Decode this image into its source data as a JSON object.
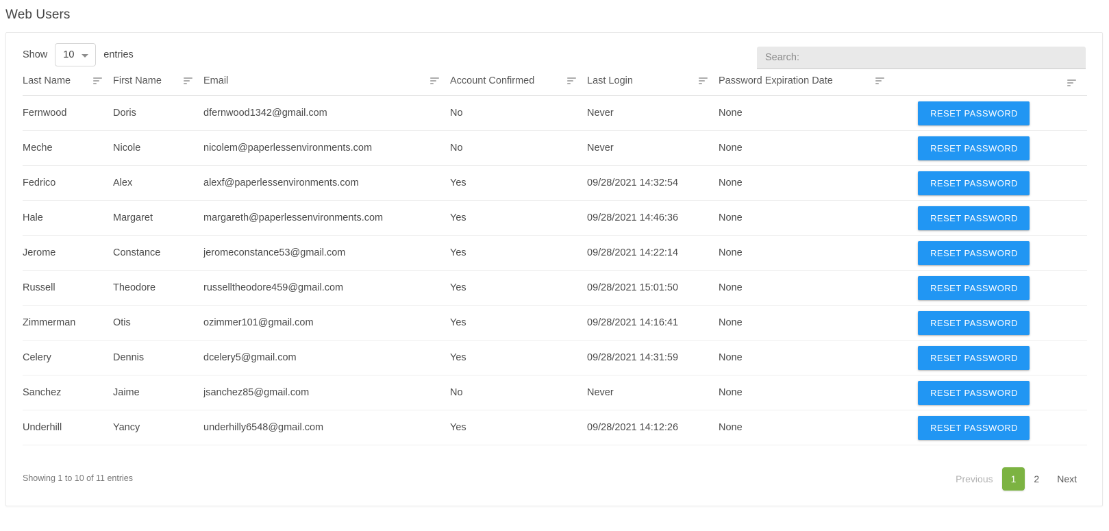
{
  "page": {
    "title": "Web Users"
  },
  "controls": {
    "length_label": "Show",
    "length_value": "10",
    "length_suffix": "entries",
    "search_placeholder": "Search:",
    "search_value": ""
  },
  "table": {
    "columns": [
      {
        "label": "Last Name",
        "sort_icon": "sort-descending-icon"
      },
      {
        "label": "First Name",
        "sort_icon": "sort-descending-icon"
      },
      {
        "label": "Email",
        "sort_icon": "sort-descending-icon"
      },
      {
        "label": "Account Confirmed",
        "sort_icon": "sort-descending-icon"
      },
      {
        "label": "Last Login",
        "sort_icon": "sort-descending-icon"
      },
      {
        "label": "Password Expiration Date",
        "sort_icon": "sort-descending-icon"
      },
      {
        "label": "",
        "sort_icon": "sort-descending-icon"
      }
    ],
    "action_label": "RESET PASSWORD",
    "rows": [
      {
        "last_name": "Fernwood",
        "first_name": "Doris",
        "email": "dfernwood1342@gmail.com",
        "account_confirmed": "No",
        "last_login": "Never",
        "password_expiration_date": "None"
      },
      {
        "last_name": "Meche",
        "first_name": "Nicole",
        "email": "nicolem@paperlessenvironments.com",
        "account_confirmed": "No",
        "last_login": "Never",
        "password_expiration_date": "None"
      },
      {
        "last_name": "Fedrico",
        "first_name": "Alex",
        "email": "alexf@paperlessenvironments.com",
        "account_confirmed": "Yes",
        "last_login": "09/28/2021 14:32:54",
        "password_expiration_date": "None"
      },
      {
        "last_name": "Hale",
        "first_name": "Margaret",
        "email": "margareth@paperlessenvironments.com",
        "account_confirmed": "Yes",
        "last_login": "09/28/2021 14:46:36",
        "password_expiration_date": "None"
      },
      {
        "last_name": "Jerome",
        "first_name": "Constance",
        "email": "jeromeconstance53@gmail.com",
        "account_confirmed": "Yes",
        "last_login": "09/28/2021 14:22:14",
        "password_expiration_date": "None"
      },
      {
        "last_name": "Russell",
        "first_name": "Theodore",
        "email": "russelltheodore459@gmail.com",
        "account_confirmed": "Yes",
        "last_login": "09/28/2021 15:01:50",
        "password_expiration_date": "None"
      },
      {
        "last_name": "Zimmerman",
        "first_name": "Otis",
        "email": "ozimmer101@gmail.com",
        "account_confirmed": "Yes",
        "last_login": "09/28/2021 14:16:41",
        "password_expiration_date": "None"
      },
      {
        "last_name": "Celery",
        "first_name": "Dennis",
        "email": "dcelery5@gmail.com",
        "account_confirmed": "Yes",
        "last_login": "09/28/2021 14:31:59",
        "password_expiration_date": "None"
      },
      {
        "last_name": "Sanchez",
        "first_name": "Jaime",
        "email": "jsanchez85@gmail.com",
        "account_confirmed": "No",
        "last_login": "Never",
        "password_expiration_date": "None"
      },
      {
        "last_name": "Underhill",
        "first_name": "Yancy",
        "email": "underhilly6548@gmail.com",
        "account_confirmed": "Yes",
        "last_login": "09/28/2021 14:12:26",
        "password_expiration_date": "None"
      }
    ]
  },
  "footer": {
    "info": "Showing 1 to 10 of 11 entries",
    "previous_label": "Previous",
    "next_label": "Next",
    "pages": [
      "1",
      "2"
    ],
    "active_page": "1"
  },
  "colors": {
    "action_button": "#2196f3",
    "active_page": "#7cb342",
    "search_background": "#e9e9e9"
  }
}
